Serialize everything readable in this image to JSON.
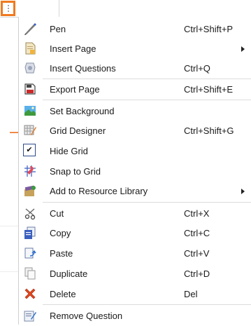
{
  "trigger": {
    "icon": "more-vertical-icon"
  },
  "menu": {
    "items": [
      {
        "label": "Pen",
        "shortcut": "Ctrl+Shift+P",
        "icon": "pen-icon"
      },
      {
        "label": "Insert Page",
        "shortcut": "",
        "submenu": true,
        "icon": "insert-page-icon"
      },
      {
        "label": "Insert Questions",
        "shortcut": "Ctrl+Q",
        "icon": "insert-questions-icon"
      },
      {
        "label": "Export Page",
        "shortcut": "Ctrl+Shift+E",
        "icon": "export-page-icon"
      },
      {
        "label": "Set Background",
        "shortcut": "",
        "icon": "landscape-image-icon"
      },
      {
        "label": "Grid Designer",
        "shortcut": "Ctrl+Shift+G",
        "icon": "grid-designer-icon"
      },
      {
        "label": "Hide Grid",
        "shortcut": "",
        "checked": true,
        "icon": "checkbox-icon"
      },
      {
        "label": "Snap to Grid",
        "shortcut": "",
        "icon": "snap-grid-icon"
      },
      {
        "label": "Add to Resource Library",
        "shortcut": "",
        "submenu": true,
        "icon": "resource-library-icon"
      },
      {
        "label": "Cut",
        "shortcut": "Ctrl+X",
        "icon": "scissors-icon"
      },
      {
        "label": "Copy",
        "shortcut": "Ctrl+C",
        "icon": "copy-icon"
      },
      {
        "label": "Paste",
        "shortcut": "Ctrl+V",
        "icon": "paste-icon"
      },
      {
        "label": "Duplicate",
        "shortcut": "Ctrl+D",
        "icon": "duplicate-icon"
      },
      {
        "label": "Delete",
        "shortcut": "Del",
        "icon": "delete-x-icon"
      },
      {
        "label": "Remove Question",
        "shortcut": "",
        "icon": "remove-question-icon"
      }
    ]
  },
  "colors": {
    "accent": "#f07a1e",
    "delete": "#e0471e"
  }
}
